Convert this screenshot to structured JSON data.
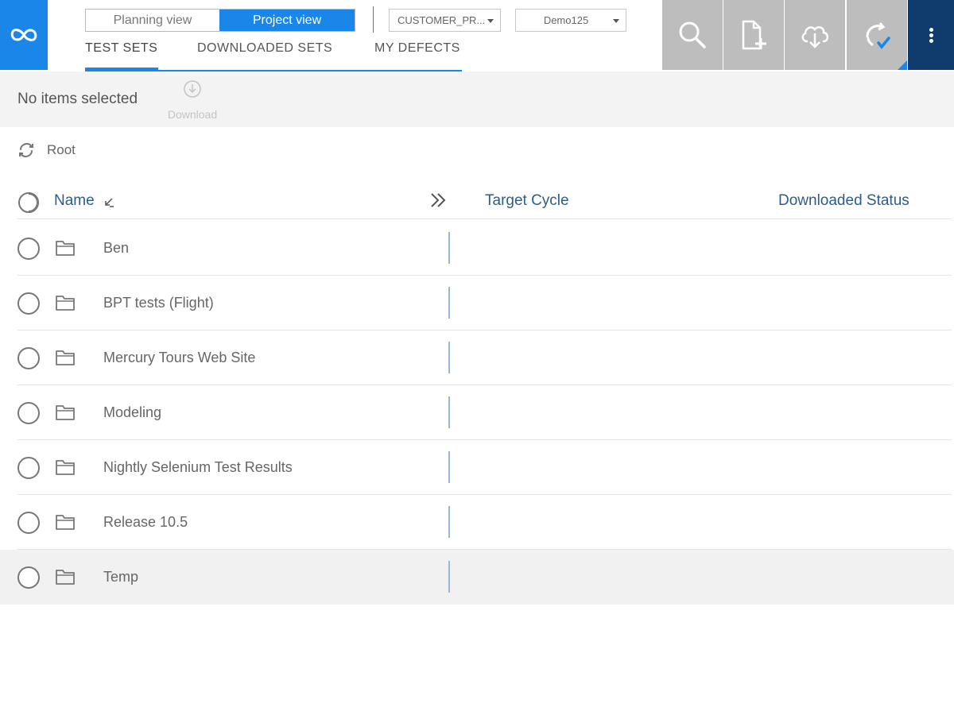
{
  "header": {
    "views": [
      {
        "label": "Planning view",
        "active": false
      },
      {
        "label": "Project view",
        "active": true
      }
    ],
    "project_select": "CUSTOMER_PR...",
    "domain_select": "Demo125",
    "tabs": [
      {
        "label": "TEST SETS",
        "active": true
      },
      {
        "label": "DOWNLOADED SETS",
        "active": false
      },
      {
        "label": "MY DEFECTS",
        "active": false
      }
    ],
    "actions": [
      "search-icon",
      "new-document-icon",
      "cloud-download-icon",
      "sync-icon"
    ],
    "accent_color": "#1a87e8",
    "menu_color": "#0f3c6d"
  },
  "toolbar": {
    "selection_status": "No items selected",
    "download_label": "Download"
  },
  "breadcrumb": {
    "root": "Root"
  },
  "table": {
    "columns": {
      "name": "Name",
      "target_cycle": "Target Cycle",
      "downloaded_status": "Downloaded Status"
    },
    "rows": [
      {
        "name": "Ben"
      },
      {
        "name": "BPT tests (Flight)"
      },
      {
        "name": "Mercury Tours Web Site"
      },
      {
        "name": "Modeling"
      },
      {
        "name": "Nightly Selenium Test Results"
      },
      {
        "name": "Release 10.5"
      },
      {
        "name": "Temp"
      }
    ]
  }
}
